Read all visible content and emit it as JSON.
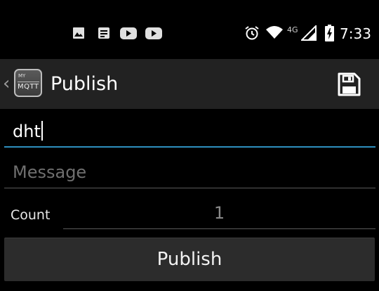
{
  "status_bar": {
    "time": "7:33",
    "network_type": "4G",
    "notification_icons": [
      "image-icon",
      "news-icon",
      "youtube-icon",
      "youtube-icon"
    ],
    "system_icons": [
      "alarm-icon",
      "wifi-icon",
      "signal-icon",
      "battery-charging-icon"
    ]
  },
  "action_bar": {
    "logo_top": "MY",
    "logo_main": "MQTT",
    "title": "Publish",
    "save_icon": "save-icon"
  },
  "form": {
    "topic_value": "dht",
    "message_placeholder": "Message",
    "count_label": "Count",
    "count_value": "1",
    "publish_label": "Publish"
  },
  "colors": {
    "accent": "#2e8fbe",
    "background": "#000000",
    "action_bar": "#222222",
    "button": "#2c2c2c"
  }
}
